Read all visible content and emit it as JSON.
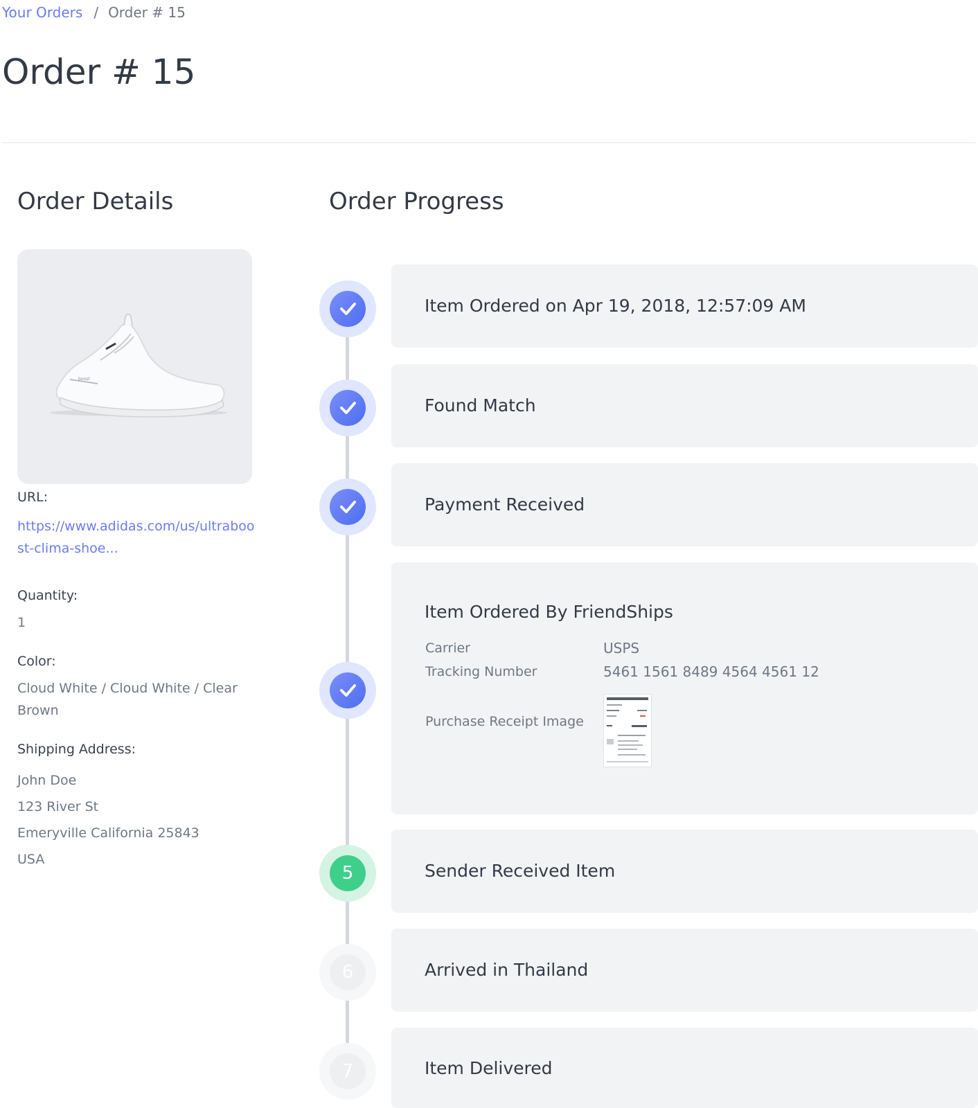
{
  "breadcrumb": {
    "parent_label": "Your Orders",
    "separator": "/",
    "current_label": "Order # 15"
  },
  "page": {
    "title": "Order # 15"
  },
  "details": {
    "heading": "Order Details",
    "url_label": "URL:",
    "url_value": "https://www.adidas.com/us/ultraboost-clima-shoe...",
    "quantity_label": "Quantity:",
    "quantity_value": "1",
    "color_label": "Color:",
    "color_value": "Cloud White / Cloud White / Clear Brown",
    "shipping_label": "Shipping Address:",
    "address": {
      "name": "John Doe",
      "street": "123 River St",
      "city_line": "Emeryville California 25843",
      "country": "USA"
    }
  },
  "progress": {
    "heading": "Order Progress",
    "steps": [
      {
        "title": "Item Ordered on Apr 19, 2018, 12:57:09 AM",
        "status": "done",
        "icon": "check-icon"
      },
      {
        "title": "Found Match",
        "status": "done",
        "icon": "check-icon"
      },
      {
        "title": "Payment Received",
        "status": "done",
        "icon": "check-icon"
      },
      {
        "title": "Item Ordered By FriendShips",
        "status": "done",
        "icon": "check-icon",
        "carrier_label": "Carrier",
        "carrier_value": "USPS",
        "tracking_label": "Tracking Number",
        "tracking_value": "5461 1561 8489 4564 4561 12",
        "receipt_label": "Purchase Receipt Image"
      },
      {
        "title": "Sender Received Item",
        "status": "active",
        "number": "5"
      },
      {
        "title": "Arrived in Thailand",
        "status": "pending",
        "number": "6"
      },
      {
        "title": "Item Delivered",
        "status": "pending",
        "number": "7"
      }
    ]
  },
  "colors": {
    "link": "#6b7cf0",
    "done": "#5a78f2",
    "active": "#3ed08a",
    "pending": "#eeeff1",
    "card": "#f2f3f5"
  }
}
